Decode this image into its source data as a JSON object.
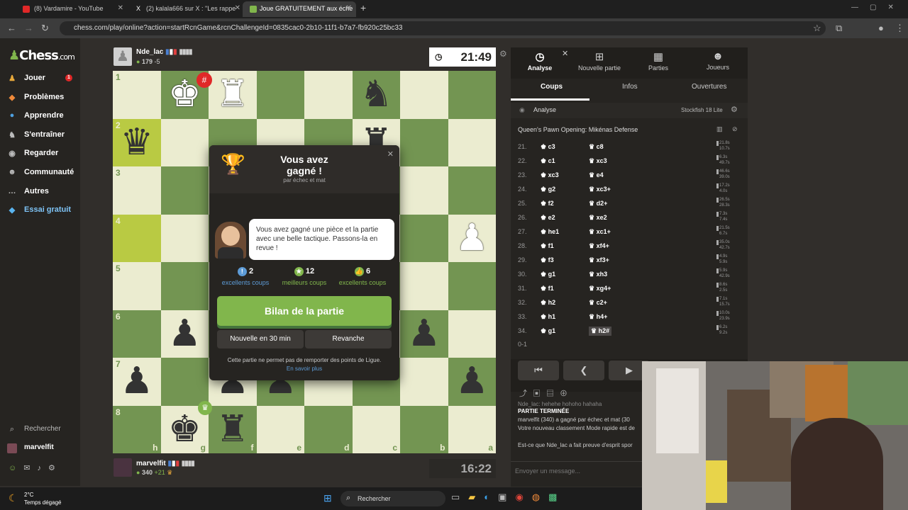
{
  "browser": {
    "tabs": [
      {
        "label": "(8) Vardamire - YouTube",
        "active": false
      },
      {
        "label": "(2) kalala666 sur X : \"Les rappe",
        "active": false
      },
      {
        "label": "Joue GRATUITEMENT aux éche",
        "active": true
      }
    ],
    "url": "chess.com/play/online?action=startRcnGame&rcnChallengeId=0835cac0-2b10-11f1-b7a7-fb920c25bc33"
  },
  "sidebar": {
    "logo": "Chess",
    "logo_suffix": ".com",
    "items": [
      {
        "label": "Jouer",
        "icon": "pawn-icon",
        "badge": "1"
      },
      {
        "label": "Problèmes",
        "icon": "puzzle-icon"
      },
      {
        "label": "Apprendre",
        "icon": "learn-icon"
      },
      {
        "label": "S'entraîner",
        "icon": "train-icon"
      },
      {
        "label": "Regarder",
        "icon": "binoculars-icon"
      },
      {
        "label": "Communauté",
        "icon": "community-icon"
      },
      {
        "label": "Autres",
        "icon": "more-icon"
      },
      {
        "label": "Essai gratuit",
        "icon": "diamond-icon"
      }
    ],
    "search_label": "Rechercher",
    "username": "marvelfit",
    "bottom_badges": [
      "2",
      "4"
    ]
  },
  "top_player": {
    "name": "Nde_lac",
    "rating": "179",
    "delta": "-5",
    "clock": "21:49"
  },
  "bottom_player": {
    "name": "marvelfit",
    "rating": "340",
    "delta": "+21",
    "clock": "16:22"
  },
  "board": {
    "ranks": [
      "1",
      "2",
      "3",
      "4",
      "5",
      "6",
      "7",
      "8"
    ],
    "files": [
      "h",
      "g",
      "f",
      "e",
      "d",
      "c",
      "b",
      "a"
    ]
  },
  "modal": {
    "title_line1": "Vous avez",
    "title_line2": "gagné !",
    "subtitle": "par échec et mat",
    "message": "Vous avez gagné une pièce et la partie avec une belle tactique. Passons-la en revue !",
    "stats": [
      {
        "value": "2",
        "label": "excellents coups",
        "color": "#5d9bd6"
      },
      {
        "value": "12",
        "label": "meilleurs coups",
        "color": "#81b64c"
      },
      {
        "value": "6",
        "label": "excellents coups",
        "color": "#81b64c"
      }
    ],
    "review_button": "Bilan de la partie",
    "new_game_button": "Nouvelle en 30 min",
    "rematch_button": "Revanche",
    "footer": "Cette partie ne permet pas de remporter des points de Ligue.",
    "footer_link": "En savoir plus"
  },
  "panel": {
    "tabs": [
      "Analyse",
      "Nouvelle partie",
      "Parties",
      "Joueurs"
    ],
    "subtabs": [
      "Coups",
      "Infos",
      "Ouvertures"
    ],
    "analysis_label": "Analyse",
    "engine": "Stockfish 18 Lite",
    "opening": "Queen's Pawn Opening: Mikénas Defense",
    "moves": [
      {
        "n": "21.",
        "w": "c3",
        "b": "c8",
        "t1": "21.8s",
        "t2": "10.7s"
      },
      {
        "n": "22.",
        "w": "c1",
        "b": "xc3",
        "t1": "6.3s",
        "t2": "49.7s"
      },
      {
        "n": "23.",
        "w": "xc3",
        "b": "e4",
        "t1": "46.6s",
        "t2": "39.0s"
      },
      {
        "n": "24.",
        "w": "g2",
        "b": "xc3+",
        "t1": "17.2s",
        "t2": "4.0s"
      },
      {
        "n": "25.",
        "w": "f2",
        "b": "d2+",
        "t1": "26.5s",
        "t2": "28.3s"
      },
      {
        "n": "26.",
        "w": "e2",
        "b": "xe2",
        "t1": "7.3s",
        "t2": "7.4s"
      },
      {
        "n": "27.",
        "w": "he1",
        "b": "xc1+",
        "t1": "21.5s",
        "t2": "6.7s"
      },
      {
        "n": "28.",
        "w": "f1",
        "b": "xf4+",
        "t1": "35.0s",
        "t2": "42.7s"
      },
      {
        "n": "29.",
        "w": "f3",
        "b": "xf3+",
        "t1": "4.9s",
        "t2": "5.9s"
      },
      {
        "n": "30.",
        "w": "g1",
        "b": "xh3",
        "t1": "5.9s",
        "t2": "42.9s"
      },
      {
        "n": "31.",
        "w": "f1",
        "b": "xg4+",
        "t1": "8.6s",
        "t2": "2.5s"
      },
      {
        "n": "32.",
        "w": "h2",
        "b": "c2+",
        "t1": "7.1s",
        "t2": "15.7s"
      },
      {
        "n": "33.",
        "w": "h1",
        "b": "h4+",
        "t1": "10.0s",
        "t2": "23.9s"
      },
      {
        "n": "34.",
        "w": "g1",
        "b": "h2#",
        "t1": "6.2s",
        "t2": "9.2s"
      }
    ],
    "result": "0-1",
    "chat": [
      "Nde_lac: hehehe hohoho hahaha",
      "PARTIE TERMINÉE",
      "marvelfit (340) a gagné par échec et mat (30",
      "Votre nouveau classement Mode rapide est de",
      "Est-ce que Nde_lac a fait preuve d'esprit spor"
    ],
    "chat_placeholder": "Envoyer un message..."
  },
  "taskbar": {
    "weather_temp": "2°C",
    "weather_desc": "Temps dégagé",
    "search": "Rechercher"
  }
}
